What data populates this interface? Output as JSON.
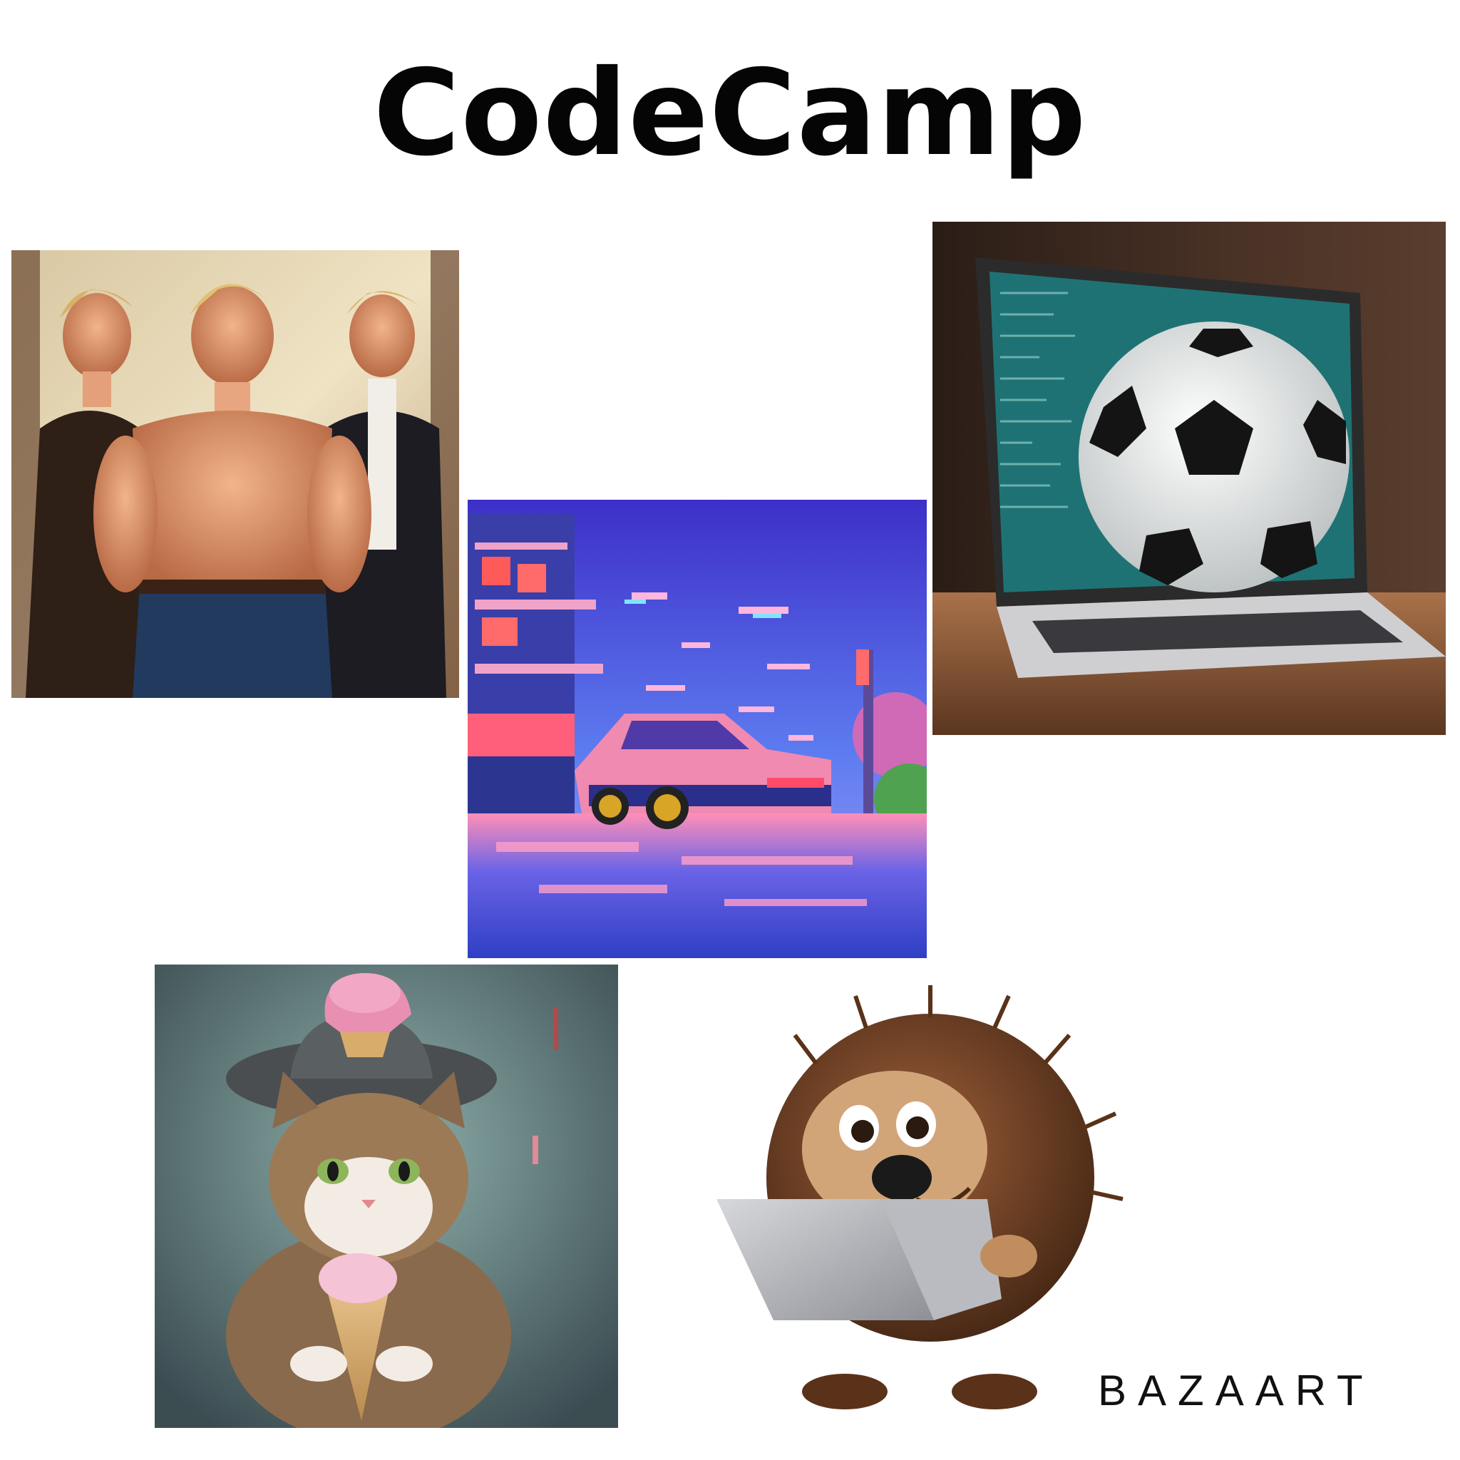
{
  "title": "CodeCamp",
  "brand_watermark": "BAZAART",
  "images": [
    {
      "name": "three-muscular-men-illustration"
    },
    {
      "name": "soccer-ball-on-laptop-photo"
    },
    {
      "name": "pixel-art-car-in-flooded-street"
    },
    {
      "name": "cat-with-ice-cream-hat-painting"
    },
    {
      "name": "hedgehog-using-laptop-render"
    }
  ],
  "colors": {
    "background": "#ffffff",
    "title": "#050505",
    "brand": "#111111"
  }
}
